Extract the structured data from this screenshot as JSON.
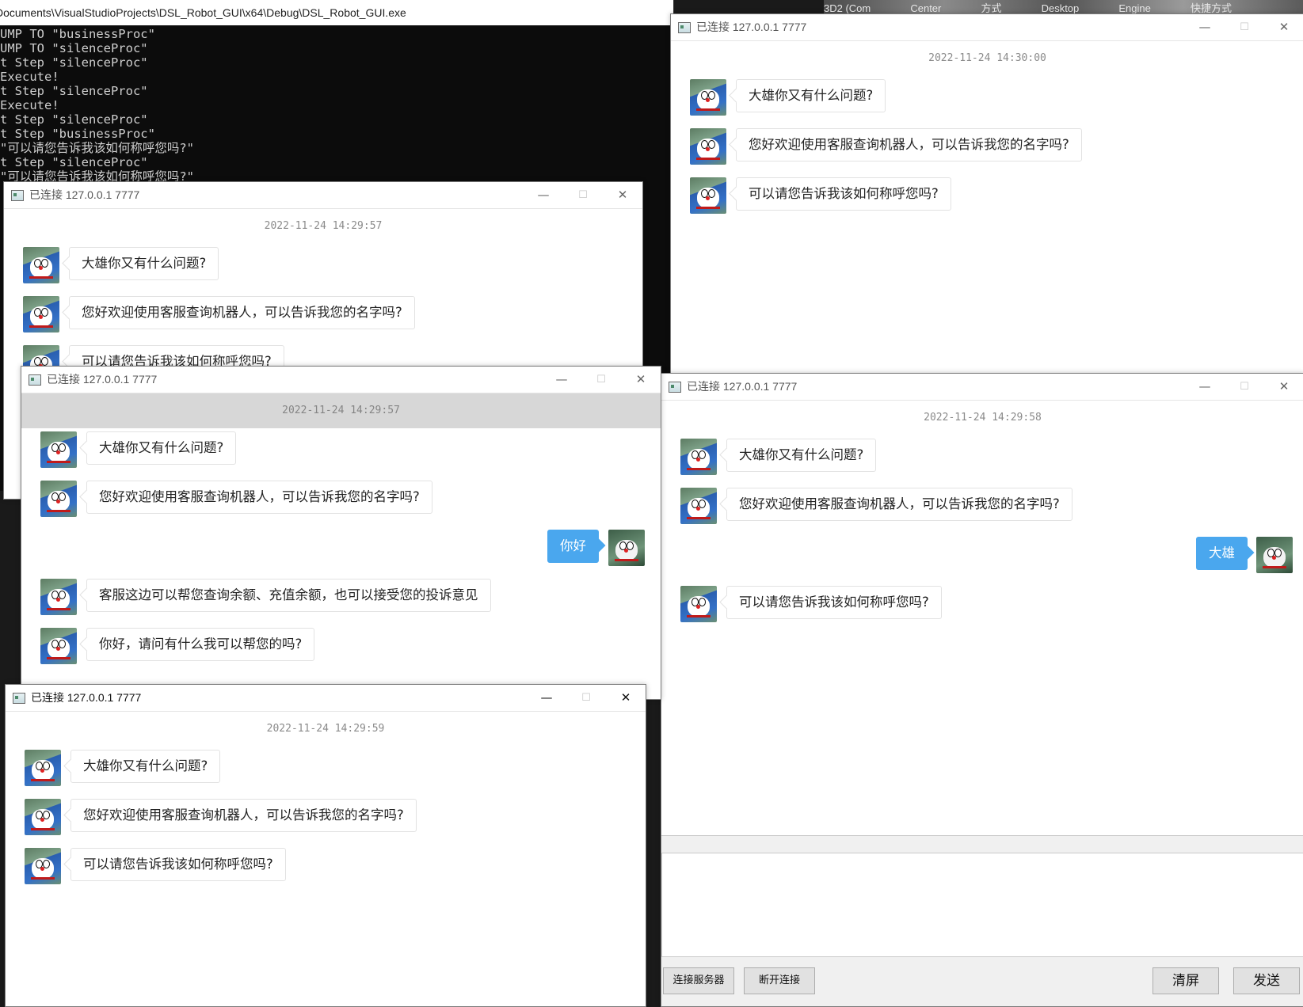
{
  "console": {
    "title": "Documents\\VisualStudioProjects\\DSL_Robot_GUI\\x64\\Debug\\DSL_Robot_GUI.exe",
    "lines": [
      "UMP TO \"businessProc\"",
      "UMP TO \"silenceProc\"",
      "t Step \"silenceProc\"",
      "Execute!",
      "t Step \"silenceProc\"",
      "Execute!",
      "t Step \"silenceProc\"",
      "t Step \"businessProc\"",
      "\"可以请您告诉我该如何称呼您吗?\"",
      "t Step \"silenceProc\"",
      "\"可以请您告诉我该如何称呼您吗?\""
    ]
  },
  "background_strip": [
    "3D2 (Com",
    "Center",
    "方式",
    "Desktop",
    "Engine",
    "快捷方式"
  ],
  "windows": {
    "w1": {
      "title": "已连接 127.0.0.1 7777",
      "timestamp": "2022-11-24 14:30:00",
      "messages": [
        "大雄你又有什么问题?",
        "您好欢迎使用客服查询机器人，可以告诉我您的名字吗?",
        "可以请您告诉我该如何称呼您吗?"
      ]
    },
    "w2": {
      "title": "已连接 127.0.0.1 7777",
      "timestamp": "2022-11-24 14:29:57",
      "messages": [
        "大雄你又有什么问题?",
        "您好欢迎使用客服查询机器人，可以告诉我您的名字吗?",
        "可以请您告诉我该如何称呼您吗?"
      ]
    },
    "w3": {
      "title": "已连接 127.0.0.1 7777",
      "timestamp": "2022-11-24 14:29:57",
      "messages": [
        "大雄你又有什么问题?",
        "您好欢迎使用客服查询机器人，可以告诉我您的名字吗?",
        "你好",
        "客服这边可以帮您查询余额、充值余额，也可以接受您的投诉意见",
        "你好，请问有什么我可以帮您的吗?"
      ]
    },
    "w4": {
      "title": "已连接 127.0.0.1 7777",
      "timestamp": "2022-11-24 14:29:58",
      "messages": [
        "大雄你又有什么问题?",
        "您好欢迎使用客服查询机器人，可以告诉我您的名字吗?",
        "大雄",
        "可以请您告诉我该如何称呼您吗?"
      ],
      "buttons": {
        "connect": "连接服务器",
        "disconnect": "断开连接",
        "clear": "清屏",
        "send": "发送"
      }
    },
    "w5": {
      "title": "已连接 127.0.0.1 7777",
      "timestamp": "2022-11-24 14:29:59",
      "messages": [
        "大雄你又有什么问题?",
        "您好欢迎使用客服查询机器人，可以告诉我您的名字吗?",
        "可以请您告诉我该如何称呼您吗?"
      ]
    }
  },
  "window_controls": {
    "minimize": "—",
    "maximize": "☐",
    "close": "✕"
  },
  "colors": {
    "user_bubble": "#4aa7ee",
    "console_bg": "#0c0c0c"
  }
}
